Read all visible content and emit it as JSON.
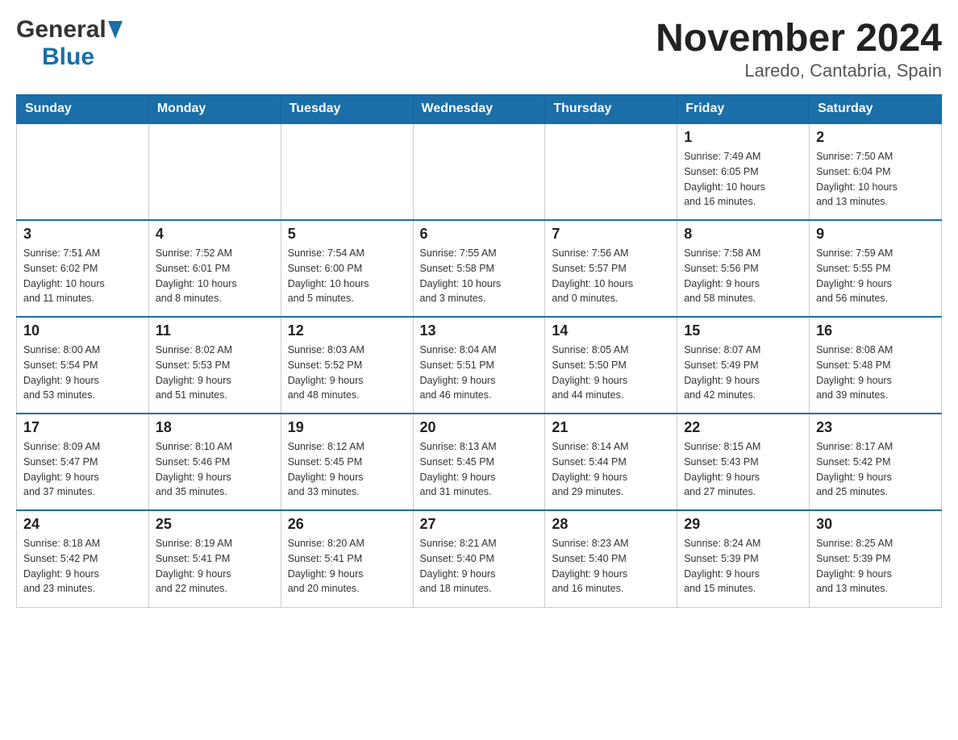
{
  "header": {
    "title": "November 2024",
    "subtitle": "Laredo, Cantabria, Spain",
    "logo_general": "General",
    "logo_blue": "Blue"
  },
  "weekdays": [
    "Sunday",
    "Monday",
    "Tuesday",
    "Wednesday",
    "Thursday",
    "Friday",
    "Saturday"
  ],
  "weeks": [
    {
      "days": [
        {
          "number": "",
          "info": ""
        },
        {
          "number": "",
          "info": ""
        },
        {
          "number": "",
          "info": ""
        },
        {
          "number": "",
          "info": ""
        },
        {
          "number": "",
          "info": ""
        },
        {
          "number": "1",
          "info": "Sunrise: 7:49 AM\nSunset: 6:05 PM\nDaylight: 10 hours\nand 16 minutes."
        },
        {
          "number": "2",
          "info": "Sunrise: 7:50 AM\nSunset: 6:04 PM\nDaylight: 10 hours\nand 13 minutes."
        }
      ]
    },
    {
      "days": [
        {
          "number": "3",
          "info": "Sunrise: 7:51 AM\nSunset: 6:02 PM\nDaylight: 10 hours\nand 11 minutes."
        },
        {
          "number": "4",
          "info": "Sunrise: 7:52 AM\nSunset: 6:01 PM\nDaylight: 10 hours\nand 8 minutes."
        },
        {
          "number": "5",
          "info": "Sunrise: 7:54 AM\nSunset: 6:00 PM\nDaylight: 10 hours\nand 5 minutes."
        },
        {
          "number": "6",
          "info": "Sunrise: 7:55 AM\nSunset: 5:58 PM\nDaylight: 10 hours\nand 3 minutes."
        },
        {
          "number": "7",
          "info": "Sunrise: 7:56 AM\nSunset: 5:57 PM\nDaylight: 10 hours\nand 0 minutes."
        },
        {
          "number": "8",
          "info": "Sunrise: 7:58 AM\nSunset: 5:56 PM\nDaylight: 9 hours\nand 58 minutes."
        },
        {
          "number": "9",
          "info": "Sunrise: 7:59 AM\nSunset: 5:55 PM\nDaylight: 9 hours\nand 56 minutes."
        }
      ]
    },
    {
      "days": [
        {
          "number": "10",
          "info": "Sunrise: 8:00 AM\nSunset: 5:54 PM\nDaylight: 9 hours\nand 53 minutes."
        },
        {
          "number": "11",
          "info": "Sunrise: 8:02 AM\nSunset: 5:53 PM\nDaylight: 9 hours\nand 51 minutes."
        },
        {
          "number": "12",
          "info": "Sunrise: 8:03 AM\nSunset: 5:52 PM\nDaylight: 9 hours\nand 48 minutes."
        },
        {
          "number": "13",
          "info": "Sunrise: 8:04 AM\nSunset: 5:51 PM\nDaylight: 9 hours\nand 46 minutes."
        },
        {
          "number": "14",
          "info": "Sunrise: 8:05 AM\nSunset: 5:50 PM\nDaylight: 9 hours\nand 44 minutes."
        },
        {
          "number": "15",
          "info": "Sunrise: 8:07 AM\nSunset: 5:49 PM\nDaylight: 9 hours\nand 42 minutes."
        },
        {
          "number": "16",
          "info": "Sunrise: 8:08 AM\nSunset: 5:48 PM\nDaylight: 9 hours\nand 39 minutes."
        }
      ]
    },
    {
      "days": [
        {
          "number": "17",
          "info": "Sunrise: 8:09 AM\nSunset: 5:47 PM\nDaylight: 9 hours\nand 37 minutes."
        },
        {
          "number": "18",
          "info": "Sunrise: 8:10 AM\nSunset: 5:46 PM\nDaylight: 9 hours\nand 35 minutes."
        },
        {
          "number": "19",
          "info": "Sunrise: 8:12 AM\nSunset: 5:45 PM\nDaylight: 9 hours\nand 33 minutes."
        },
        {
          "number": "20",
          "info": "Sunrise: 8:13 AM\nSunset: 5:45 PM\nDaylight: 9 hours\nand 31 minutes."
        },
        {
          "number": "21",
          "info": "Sunrise: 8:14 AM\nSunset: 5:44 PM\nDaylight: 9 hours\nand 29 minutes."
        },
        {
          "number": "22",
          "info": "Sunrise: 8:15 AM\nSunset: 5:43 PM\nDaylight: 9 hours\nand 27 minutes."
        },
        {
          "number": "23",
          "info": "Sunrise: 8:17 AM\nSunset: 5:42 PM\nDaylight: 9 hours\nand 25 minutes."
        }
      ]
    },
    {
      "days": [
        {
          "number": "24",
          "info": "Sunrise: 8:18 AM\nSunset: 5:42 PM\nDaylight: 9 hours\nand 23 minutes."
        },
        {
          "number": "25",
          "info": "Sunrise: 8:19 AM\nSunset: 5:41 PM\nDaylight: 9 hours\nand 22 minutes."
        },
        {
          "number": "26",
          "info": "Sunrise: 8:20 AM\nSunset: 5:41 PM\nDaylight: 9 hours\nand 20 minutes."
        },
        {
          "number": "27",
          "info": "Sunrise: 8:21 AM\nSunset: 5:40 PM\nDaylight: 9 hours\nand 18 minutes."
        },
        {
          "number": "28",
          "info": "Sunrise: 8:23 AM\nSunset: 5:40 PM\nDaylight: 9 hours\nand 16 minutes."
        },
        {
          "number": "29",
          "info": "Sunrise: 8:24 AM\nSunset: 5:39 PM\nDaylight: 9 hours\nand 15 minutes."
        },
        {
          "number": "30",
          "info": "Sunrise: 8:25 AM\nSunset: 5:39 PM\nDaylight: 9 hours\nand 13 minutes."
        }
      ]
    }
  ]
}
